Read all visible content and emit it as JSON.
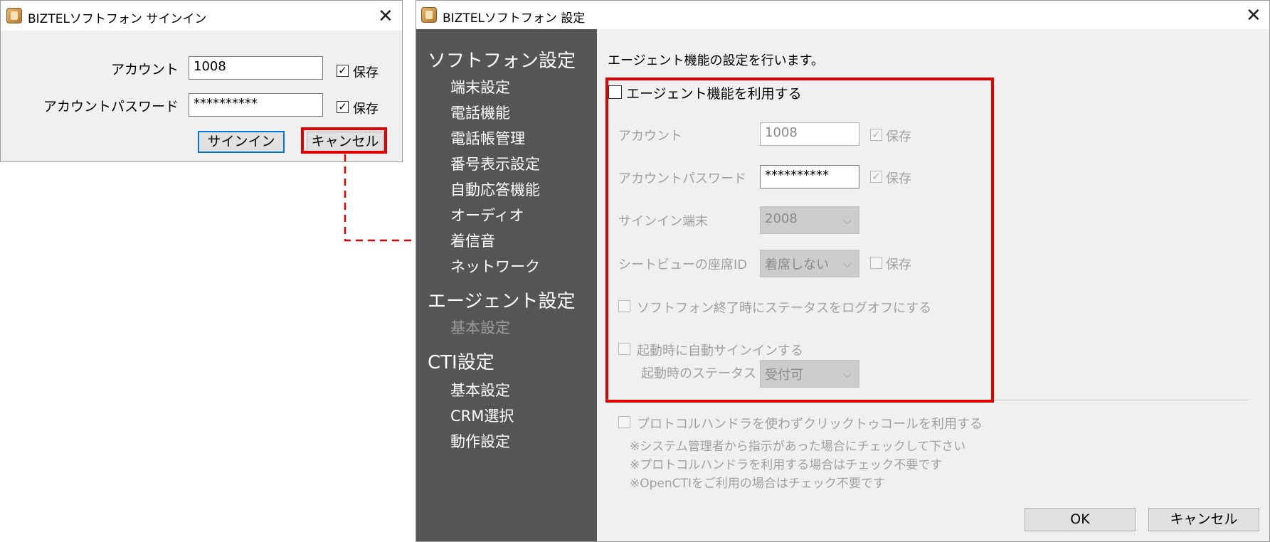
{
  "signin": {
    "title": "BIZTELソフトフォン サインイン",
    "close": "✕",
    "account_label": "アカウント",
    "account_value": "1008",
    "account_save_check": "✓",
    "account_save_label": "保存",
    "password_label": "アカウントパスワード",
    "password_value": "**********",
    "password_save_check": "✓",
    "password_save_label": "保存",
    "signin_button": "サインイン",
    "cancel_button": "キャンセル"
  },
  "settings": {
    "title": "BIZTELソフトフォン 設定",
    "close": "✕",
    "sidebar": {
      "softphone_header": "ソフトフォン設定",
      "softphone_items": [
        "端末設定",
        "電話機能",
        "電話帳管理",
        "番号表示設定",
        "自動応答機能",
        "オーディオ",
        "着信音",
        "ネットワーク"
      ],
      "agent_header": "エージェント設定",
      "agent_items": [
        "基本設定"
      ],
      "cti_header": "CTI設定",
      "cti_items": [
        "基本設定",
        "CRM選択",
        "動作設定"
      ]
    },
    "main": {
      "intro": "エージェント機能の設定を行います。",
      "use_agent_label": "エージェント機能を利用する",
      "account_label": "アカウント",
      "account_value": "1008",
      "account_save_check": "✓",
      "account_save_label": "保存",
      "password_label": "アカウントパスワード",
      "password_value": "**********",
      "password_save_check": "✓",
      "password_save_label": "保存",
      "terminal_label": "サインイン端末",
      "terminal_value": "2008",
      "seat_label": "シートビューの座席ID",
      "seat_value": "着席しない",
      "seat_save_label": "保存",
      "logoff_label": "ソフトフォン終了時にステータスをログオフにする",
      "autosignin_label": "起動時に自動サインインする",
      "startup_status_label": "起動時のステータス",
      "startup_status_value": "受付可",
      "protocol_label": "プロトコルハンドラを使わずクリックトゥコールを利用する",
      "notes": [
        "※システム管理者から指示があった場合にチェックして下さい",
        "※プロトコルハンドラを利用する場合はチェック不要です",
        "※OpenCTIをご利用の場合はチェック不要です"
      ],
      "ok_button": "OK",
      "cancel_button": "キャンセル",
      "caret": "⌵"
    }
  },
  "colors": {
    "highlight": "#e00000",
    "sidebar_bg": "#555555",
    "disabled_text": "#a0a0a0"
  }
}
